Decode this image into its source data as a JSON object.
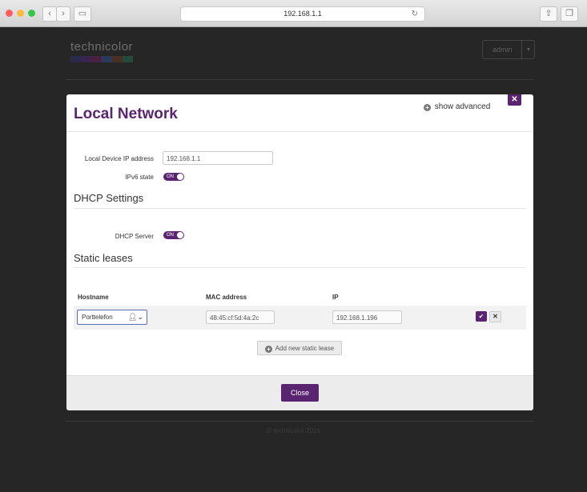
{
  "browser": {
    "url": "192.168.1.1",
    "colors": {
      "close": "#fc605c",
      "minimize": "#fdbc40",
      "zoom": "#34c84a"
    }
  },
  "page": {
    "logo_text": "technicolor",
    "admin_label": "admin",
    "footer_text": "© technicolor 2016"
  },
  "modal": {
    "title": "Local Network",
    "show_advanced": "show advanced",
    "local_ip_label": "Local Device IP address",
    "local_ip_value": "192.168.1.1",
    "ipv6_label": "IPv6 state",
    "ipv6_toggle": "ON",
    "dhcp_section": "DHCP Settings",
    "dhcp_server_label": "DHCP Server",
    "dhcp_toggle": "ON",
    "static_section": "Static leases",
    "table": {
      "headers": [
        "Hostname",
        "MAC address",
        "IP"
      ],
      "row": {
        "hostname": "Porttelefon",
        "mac": "48:45:cf:5d:4a:2c",
        "ip": "192.168.1.196"
      }
    },
    "add_lease": "Add new static lease",
    "close_label": "Close"
  },
  "theme": {
    "accent": "#5a2471"
  }
}
